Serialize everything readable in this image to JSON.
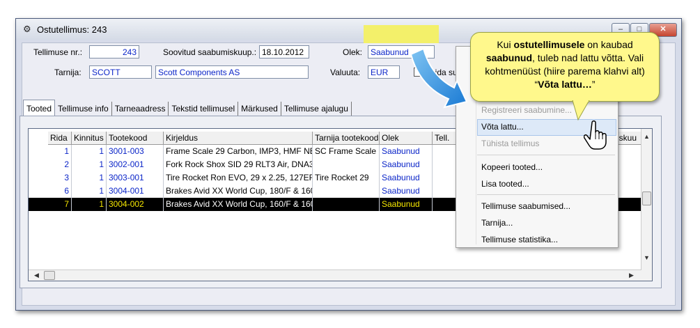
{
  "window": {
    "title": "Ostutellimus: 243",
    "buttons": {
      "minimize": "–",
      "maximize": "□",
      "close": "✕"
    }
  },
  "form": {
    "order_no_label": "Tellimuse nr.:",
    "order_no": "243",
    "arrival_label": "Soovitud saabumiskuup.:",
    "arrival_date": "18.10.2012",
    "state_label": "Olek:",
    "state_value": "Saabunud",
    "supplier_label": "Tarnija:",
    "supplier_code": "SCOTT",
    "supplier_name": "Scott Components AS",
    "currency_label": "Valuuta:",
    "currency_value": "EUR",
    "hide_label": "Peida su"
  },
  "tabs": [
    {
      "label": "Tooted"
    },
    {
      "label": "Tellimuse info"
    },
    {
      "label": "Tarneaadress"
    },
    {
      "label": "Tekstid tellimusel"
    },
    {
      "label": "Märkused"
    },
    {
      "label": "Tellimuse ajalugu"
    }
  ],
  "grid": {
    "headers": [
      "Rida",
      "Kinnitus",
      "Tootekood",
      "Kirjeldus",
      "Tarnija tootekood",
      "Olek",
      "Tell.",
      "iskuu"
    ],
    "rows": [
      {
        "rida": "1",
        "kinnitus": "1",
        "kood": "3001-003",
        "kirjeldus": "Frame Scale 29 Carbon, IMP3, HMF NE",
        "tarnija_kood": "SC Frame Scale",
        "olek": "Saabunud"
      },
      {
        "rida": "2",
        "kinnitus": "1",
        "kood": "3002-001",
        "kirjeldus": "Fork Rock Shox SID 29 RLT3 Air, DNA3",
        "tarnija_kood": "",
        "olek": "Saabunud"
      },
      {
        "rida": "3",
        "kinnitus": "1",
        "kood": "3003-001",
        "kirjeldus": "Tire Rocket Ron EVO, 29 x 2.25, 127EF",
        "tarnija_kood": "Tire Rocket 29",
        "olek": "Saabunud"
      },
      {
        "rida": "6",
        "kinnitus": "1",
        "kood": "3004-001",
        "kirjeldus": "Brakes Avid XX World Cup, 180/F & 160",
        "tarnija_kood": "",
        "olek": "Saabunud"
      },
      {
        "rida": "7",
        "kinnitus": "1",
        "kood": "3004-002",
        "kirjeldus": "Brakes Avid XX World Cup, 160/F & 160",
        "tarnija_kood": "",
        "olek": "Saabunud"
      }
    ]
  },
  "menu": {
    "items": [
      {
        "label": "Registreeri saabumine...",
        "disabled": true
      },
      {
        "label": "Võta lattu...",
        "disabled": false
      },
      {
        "label": "Tühista tellimus",
        "disabled": true
      },
      {
        "label": "Kopeeri tooted...",
        "disabled": false
      },
      {
        "label": "Lisa tooted...",
        "disabled": false
      },
      {
        "label": "Tellimuse saabumised...",
        "disabled": false
      },
      {
        "label": "Tarnija...",
        "disabled": false
      },
      {
        "label": "Tellimuse statistika...",
        "disabled": false
      }
    ]
  },
  "callout": {
    "p1": "Kui ",
    "b1": "ostutellimusele",
    "p2": " on kaubad ",
    "b2": "saabunud",
    "p3": ",  tuleb nad lattu võtta. Vali kohtmenüüst (hiire parema klahvi alt) “",
    "b3": "Võta lattu…",
    "p4": "”"
  },
  "colors": {
    "accent_blue": "#0b25c8",
    "callout_bg": "#fff88c",
    "highlight": "#f3f06a",
    "selected_text": "#f5e600"
  }
}
